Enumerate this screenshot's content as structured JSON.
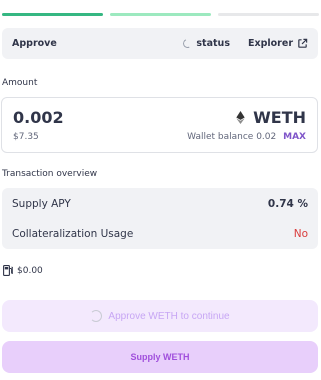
{
  "step": {
    "title": "Approve",
    "status_label": "status",
    "explorer_label": "Explorer"
  },
  "amount": {
    "section_label": "Amount",
    "value": "0.002",
    "usd_value": "$7.35",
    "token_symbol": "WETH",
    "wallet_balance_label": "Wallet balance",
    "wallet_balance_value": "0.02",
    "max_label": "MAX"
  },
  "overview": {
    "section_label": "Transaction overview",
    "rows": [
      {
        "label": "Supply APY",
        "value": "0.74 %"
      },
      {
        "label": "Collateralization Usage",
        "value": "No"
      }
    ]
  },
  "gas": {
    "value": "$0.00"
  },
  "buttons": {
    "approve_label": "Approve WETH to continue",
    "supply_label": "Supply WETH"
  },
  "colors": {
    "progress_done": "#35b782",
    "progress_active": "#9ce9bf",
    "progress_pending": "#e7e8ea",
    "max_accent": "#7f55c9",
    "no_red": "#d93c3c",
    "button_bg": "#e8cffb"
  }
}
